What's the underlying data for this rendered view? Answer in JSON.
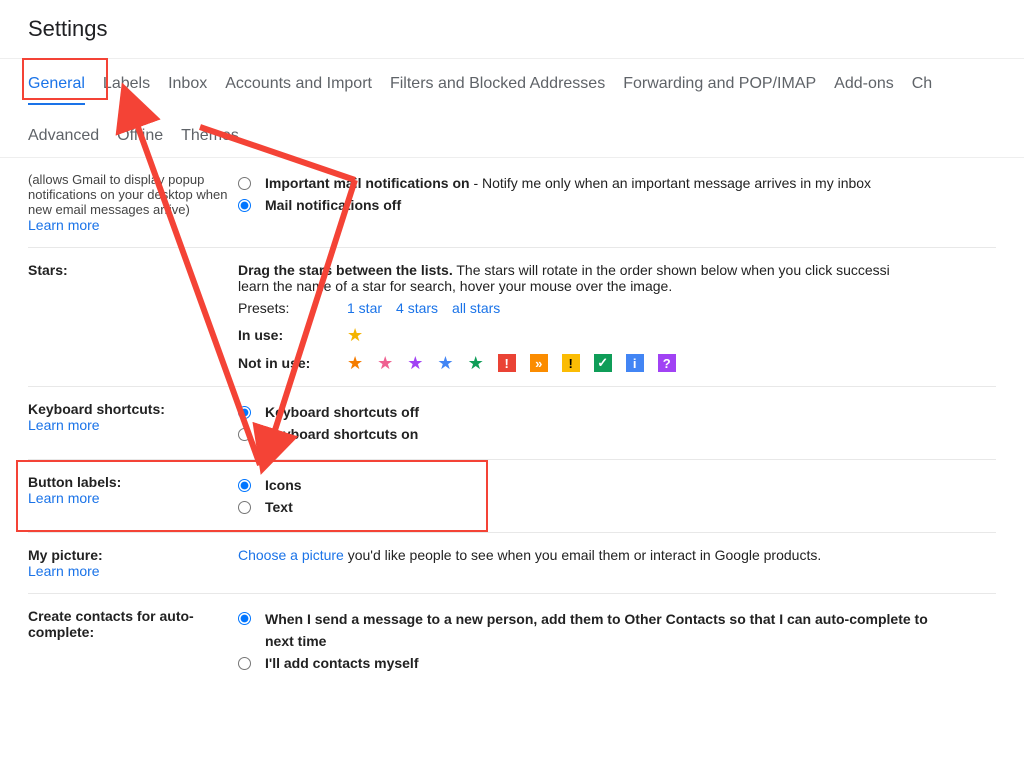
{
  "title": "Settings",
  "tabs": {
    "general": "General",
    "labels": "Labels",
    "inbox": "Inbox",
    "accounts": "Accounts and Import",
    "filters": "Filters and Blocked Addresses",
    "forwarding": "Forwarding and POP/IMAP",
    "addons": "Add-ons",
    "chat": "Ch",
    "advanced": "Advanced",
    "offline": "Offline",
    "themes": "Themes"
  },
  "notifications": {
    "desc": "(allows Gmail to display popup notifications on your desktop when new email messages arrive)",
    "learn_more": "Learn more",
    "important_on": "Important mail notifications on",
    "important_on_desc": " - Notify me only when an important message arrives in my inbox",
    "off": "Mail notifications off"
  },
  "stars": {
    "heading": "Stars:",
    "drag_label": "Drag the stars between the lists.",
    "drag_desc": "  The stars will rotate in the order shown below when you click successi",
    "drag_desc2": "learn the name of a star for search, hover your mouse over the image.",
    "presets_label": "Presets:",
    "preset1": "1 star",
    "preset2": "4 stars",
    "preset3": "all stars",
    "in_use": "In use:",
    "not_in_use": "Not in use:",
    "mark_excl": "!",
    "mark_raquo": "»",
    "mark_excl2": "!",
    "mark_check": "✓",
    "mark_info": "i",
    "mark_q": "?"
  },
  "keyboard": {
    "heading": "Keyboard shortcuts:",
    "learn_more": "Learn more",
    "off": "Keyboard shortcuts off",
    "on": "Keyboard shortcuts on"
  },
  "button_labels": {
    "heading": "Button labels:",
    "learn_more": "Learn more",
    "icons": "Icons",
    "text": "Text"
  },
  "picture": {
    "heading": "My picture:",
    "learn_more": "Learn more",
    "choose": "Choose a picture",
    "desc": " you'd like people to see when you email them or interact in Google products."
  },
  "contacts": {
    "heading": "Create contacts for auto-complete:",
    "auto": "When I send a message to a new person, add them to Other Contacts so that I can auto-complete to",
    "auto2": "next time",
    "manual": "I'll add contacts myself"
  }
}
